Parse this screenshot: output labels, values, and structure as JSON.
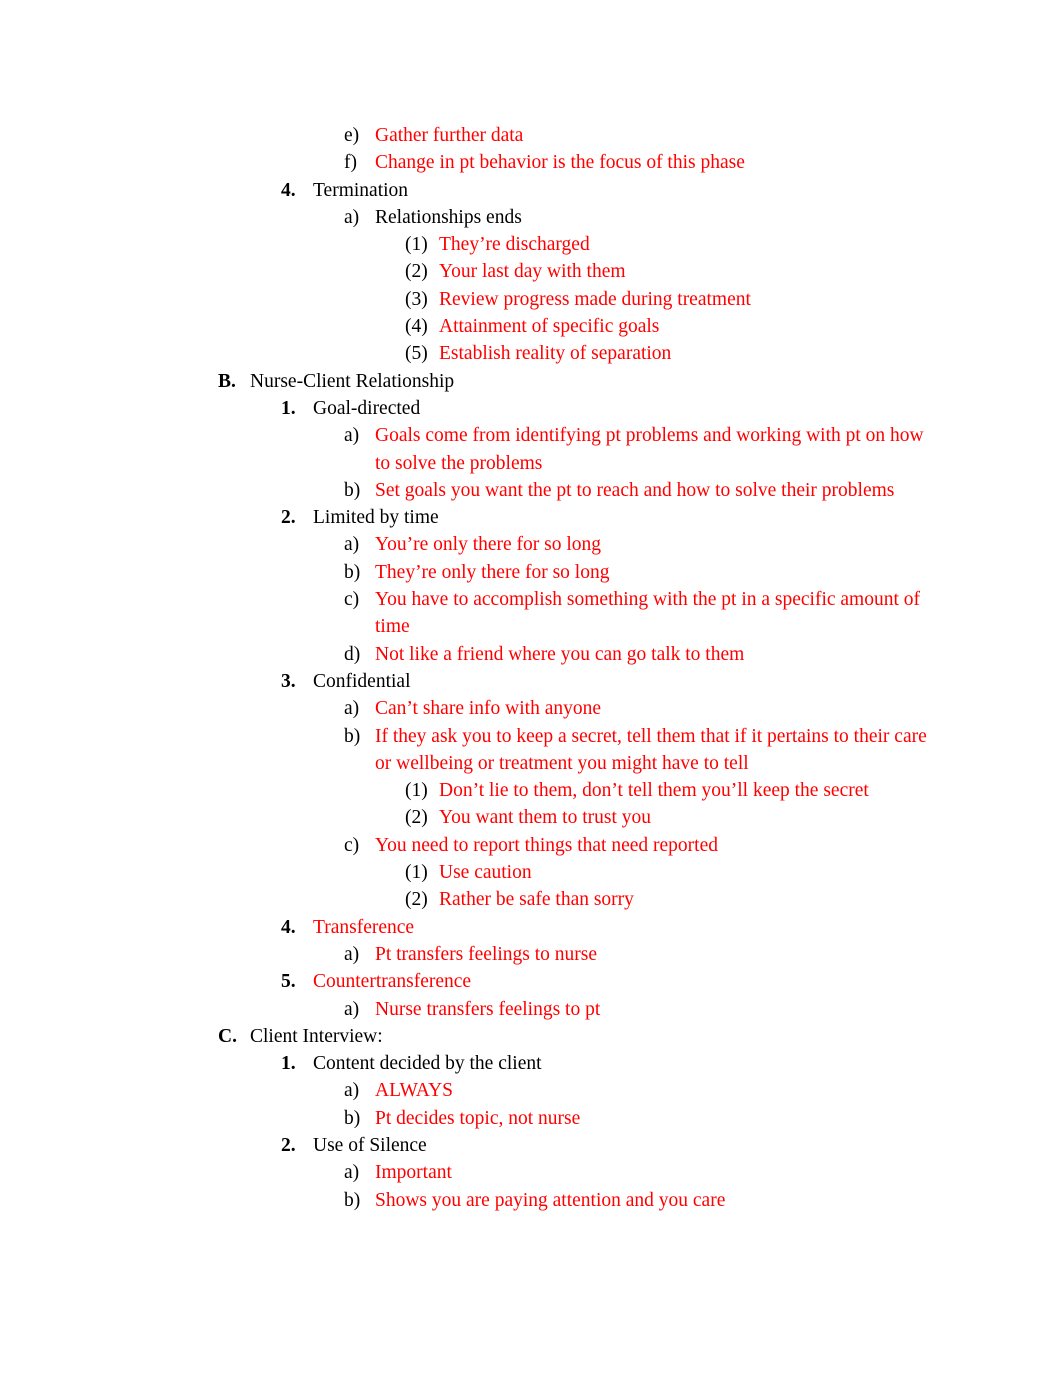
{
  "document": {
    "type": "outline-notes",
    "accent_color": "#FF0000",
    "text_color": "#000000",
    "background_color": "#FFFFFF"
  },
  "outline": [
    {
      "level": 3,
      "marker": "e)",
      "text": "Gather further data",
      "color": "red"
    },
    {
      "level": 3,
      "marker": "f)",
      "text": "Change in pt behavior is the focus of this phase",
      "color": "red"
    },
    {
      "level": 2,
      "marker": "4.",
      "text": "Termination",
      "color": "black"
    },
    {
      "level": 3,
      "marker": "a)",
      "text": "Relationships ends",
      "color": "black"
    },
    {
      "level": 4,
      "marker": "(1)",
      "text": "They’re discharged",
      "color": "red"
    },
    {
      "level": 4,
      "marker": "(2)",
      "text": "Your last day with them",
      "color": "red"
    },
    {
      "level": 4,
      "marker": "(3)",
      "text": "Review progress made during treatment",
      "color": "red"
    },
    {
      "level": 4,
      "marker": "(4)",
      "text": "Attainment of specific goals",
      "color": "red"
    },
    {
      "level": 4,
      "marker": "(5)",
      "text": "Establish reality of separation",
      "color": "red"
    },
    {
      "level": 1,
      "marker": "B.",
      "text": "Nurse-Client Relationship",
      "color": "black"
    },
    {
      "level": 2,
      "marker": "1.",
      "text": "Goal-directed",
      "color": "black"
    },
    {
      "level": 3,
      "marker": "a)",
      "text": "Goals come from identifying pt problems and working with pt on how to solve the problems",
      "color": "red"
    },
    {
      "level": 3,
      "marker": "b)",
      "text": "Set goals you want the pt to reach and how to solve their problems",
      "color": "red"
    },
    {
      "level": 2,
      "marker": "2.",
      "text": "Limited by time",
      "color": "black"
    },
    {
      "level": 3,
      "marker": "a)",
      "text": "You’re only there for so long",
      "color": "red"
    },
    {
      "level": 3,
      "marker": "b)",
      "text": "They’re only there for so long",
      "color": "red"
    },
    {
      "level": 3,
      "marker": "c)",
      "text": "You have to accomplish something with the pt in a specific amount of time",
      "color": "red"
    },
    {
      "level": 3,
      "marker": "d)",
      "text": "Not like a friend where you can go talk to them",
      "color": "red"
    },
    {
      "level": 2,
      "marker": "3.",
      "text": "Confidential",
      "color": "black"
    },
    {
      "level": 3,
      "marker": "a)",
      "text": "Can’t share info with anyone",
      "color": "red"
    },
    {
      "level": 3,
      "marker": "b)",
      "text": "If they ask you to keep a secret, tell them that if it pertains to their care or wellbeing or treatment you might have to tell",
      "color": "red"
    },
    {
      "level": 4,
      "marker": "(1)",
      "text": "Don’t lie to them, don’t tell them you’ll keep the secret",
      "color": "red"
    },
    {
      "level": 4,
      "marker": "(2)",
      "text": "You want them to trust you",
      "color": "red"
    },
    {
      "level": 3,
      "marker": "c)",
      "text": "You need to report things that need reported",
      "color": "red"
    },
    {
      "level": 4,
      "marker": "(1)",
      "text": "Use caution",
      "color": "red"
    },
    {
      "level": 4,
      "marker": "(2)",
      "text": "Rather be safe than sorry",
      "color": "red"
    },
    {
      "level": 2,
      "marker": "4.",
      "text": "Transference",
      "color": "red"
    },
    {
      "level": 3,
      "marker": "a)",
      "text": "Pt transfers feelings to nurse",
      "color": "red"
    },
    {
      "level": 2,
      "marker": "5.",
      "text": "Countertransference",
      "color": "red"
    },
    {
      "level": 3,
      "marker": "a)",
      "text": "Nurse transfers feelings to pt",
      "color": "red"
    },
    {
      "level": 1,
      "marker": "C.",
      "text": "Client Interview:",
      "color": "black"
    },
    {
      "level": 2,
      "marker": "1.",
      "text": "Content decided by the client",
      "color": "black"
    },
    {
      "level": 3,
      "marker": "a)",
      "text": "ALWAYS",
      "color": "red"
    },
    {
      "level": 3,
      "marker": "b)",
      "text": "Pt decides topic, not nurse",
      "color": "red"
    },
    {
      "level": 2,
      "marker": "2.",
      "text": "Use of Silence",
      "color": "black"
    },
    {
      "level": 3,
      "marker": "a)",
      "text": "Important",
      "color": "red"
    },
    {
      "level": 3,
      "marker": "b)",
      "text": "Shows you are paying attention and you care",
      "color": "red"
    }
  ]
}
